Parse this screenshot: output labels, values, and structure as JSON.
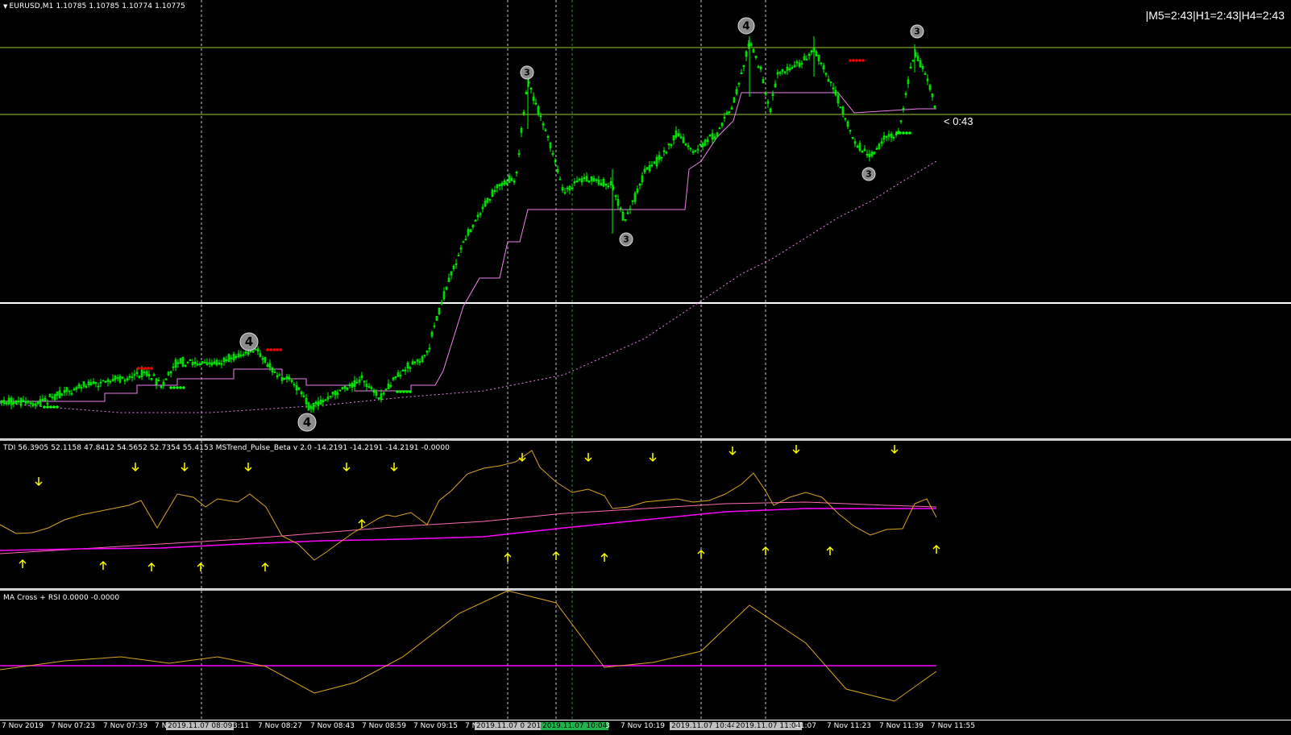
{
  "main": {
    "title": "EURUSD,M1  1.10785 1.10785 1.10774 1.10775",
    "timer_label": "|M5=2:43|H1=2:43|H4=2:43",
    "countdown_label": "< 0:43",
    "wave_labels": [
      "4",
      "3",
      "3",
      "4",
      "3",
      "4",
      "3"
    ]
  },
  "tdi": {
    "title": "TDI 56.3905 52.1158 47.8412 54.5652 52.7354 55.4153  MSTrend_Pulse_Beta v 2.0 -14.2191 -14.2191 -14.2191 -0.0000"
  },
  "rsi": {
    "title": "MA Cross + RSI 0.0000 -0.0000"
  },
  "time_axis": {
    "labels": [
      "7 Nov 2019",
      "7 Nov 07:23",
      "7 Nov 07:39",
      "7 N",
      "3:11",
      "7 Nov 08:27",
      "7 Nov 08:43",
      "7 Nov 08:59",
      "7 Nov 09:15",
      "7 N",
      "3",
      "7 Nov 10:19",
      "11:07",
      "7 Nov 11:23",
      "7 Nov 11:39",
      "7 Nov 11:55"
    ],
    "boxes": [
      "2019.11.07 08:09",
      "2019.11.07 0",
      "201",
      "2019.11.07 10:04",
      "2019.11.07 10:44",
      "2019.11.07 11:04"
    ]
  },
  "colors": {
    "candle": "#00ff00",
    "stop_line": "#ee82ee",
    "signal_red": "#ff0000",
    "signal_green": "#00ff00",
    "arrow": "#ffff00",
    "tdi_line": "#daa520",
    "tdi_ma": "#ff69b4"
  }
}
